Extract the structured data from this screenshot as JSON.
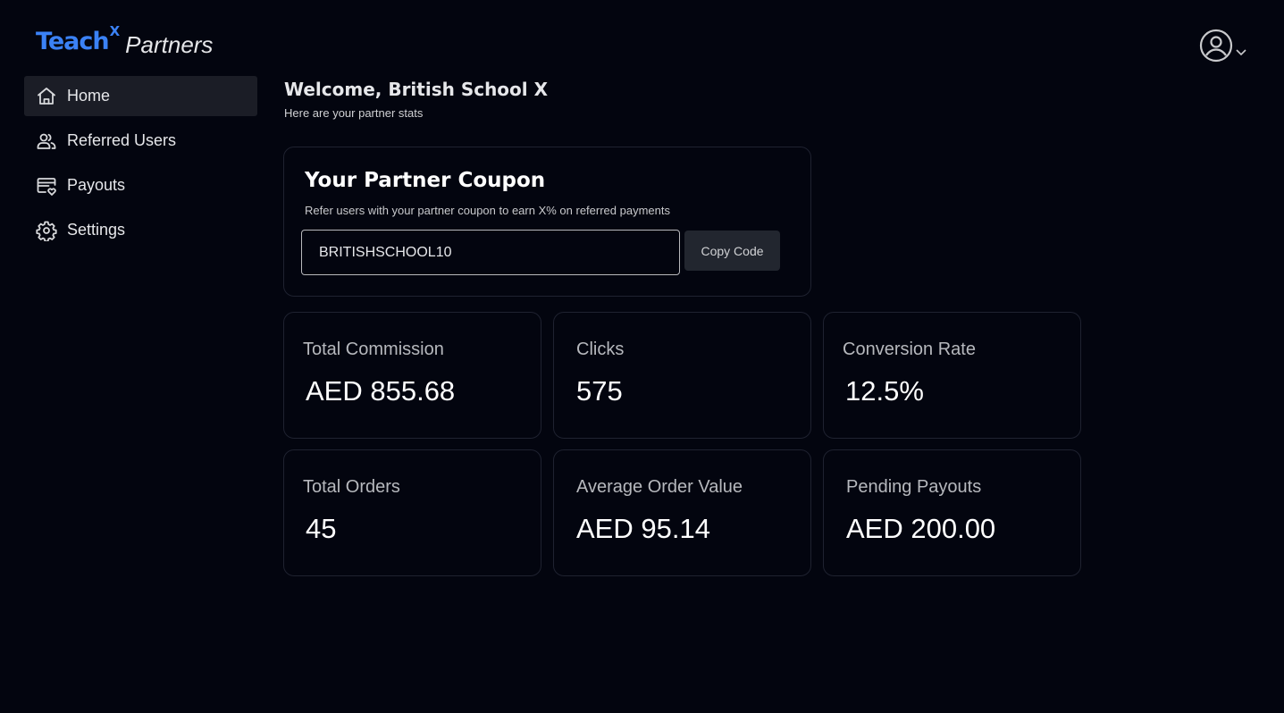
{
  "brand": {
    "name": "Teach",
    "superscript": "X",
    "suffix": "Partners",
    "accent_color": "#3b82f6"
  },
  "sidebar": {
    "items": [
      {
        "label": "Home",
        "icon": "home-icon",
        "active": true
      },
      {
        "label": "Referred Users",
        "icon": "users-icon",
        "active": false
      },
      {
        "label": "Payouts",
        "icon": "payout-card-icon",
        "active": false
      },
      {
        "label": "Settings",
        "icon": "gear-icon",
        "active": false
      }
    ]
  },
  "header": {
    "user_icon": "user-circle-icon",
    "dropdown_icon": "chevron-down-icon"
  },
  "welcome": {
    "title": "Welcome, British School X",
    "subtitle": "Here are your partner stats"
  },
  "coupon": {
    "title": "Your Partner Coupon",
    "description": "Refer users with your partner coupon to earn X% on referred payments",
    "code": "BRITISHSCHOOL10",
    "copy_label": "Copy Code"
  },
  "stats": [
    {
      "label": "Total Commission",
      "value": "AED 855.68"
    },
    {
      "label": "Clicks",
      "value": "575"
    },
    {
      "label": "Conversion Rate",
      "value": "12.5%"
    },
    {
      "label": "Total Orders",
      "value": "45"
    },
    {
      "label": "Average Order Value",
      "value": "AED 95.14"
    },
    {
      "label": "Pending Payouts",
      "value": "AED 200.00"
    }
  ]
}
